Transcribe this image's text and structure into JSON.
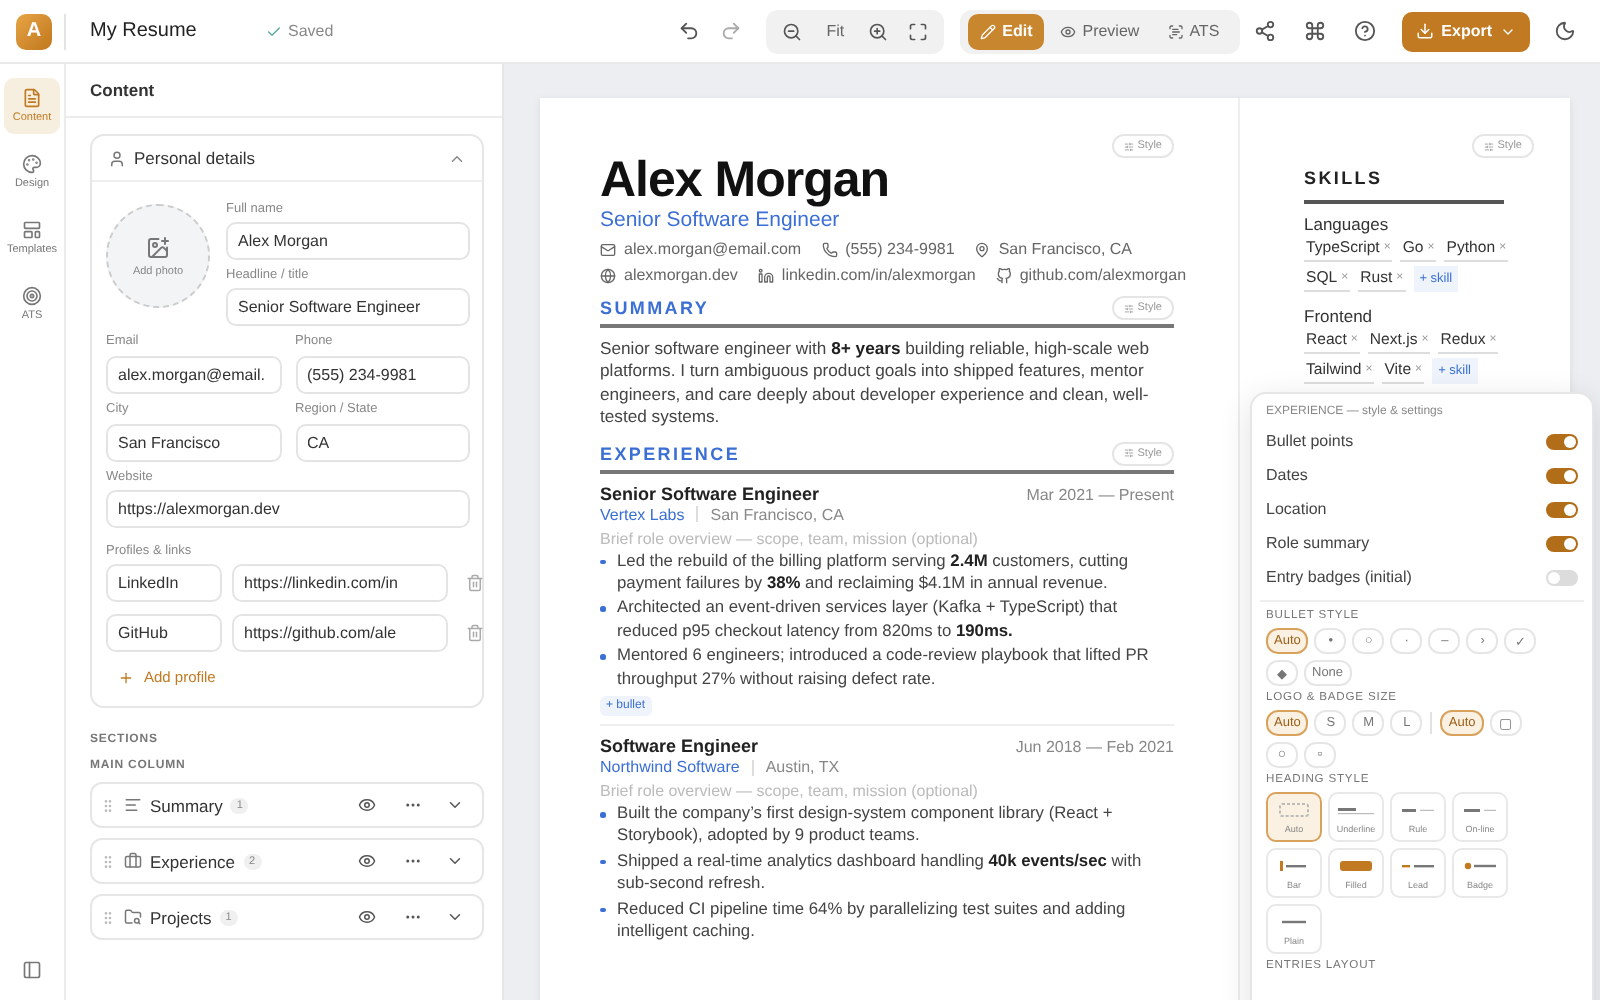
{
  "topbar": {
    "logo_letter": "A",
    "doc_title": "My Resume",
    "save_status": "Saved",
    "zoom_fit": "Fit",
    "modes": [
      {
        "label": "Edit",
        "kind": "edit",
        "selected": true
      },
      {
        "label": "Preview",
        "kind": "preview",
        "selected": false
      },
      {
        "label": "ATS",
        "kind": "ats",
        "selected": false
      }
    ],
    "export_label": "Export"
  },
  "rail": {
    "items": [
      {
        "label": "Content",
        "kind": "content",
        "selected": true
      },
      {
        "label": "Design",
        "kind": "design",
        "selected": false
      },
      {
        "label": "Templates",
        "kind": "templates",
        "selected": false
      },
      {
        "label": "ATS",
        "kind": "ats",
        "selected": false
      }
    ]
  },
  "panel": {
    "title": "Content",
    "personal": {
      "title": "Personal details",
      "expanded": true,
      "photo_label": "Add photo",
      "name_fields": [
        {
          "label": "Full name",
          "value": "Alex Morgan"
        },
        {
          "label": "Headline / title",
          "value": "Senior Software Engineer"
        }
      ],
      "grid_fields": [
        {
          "label": "Email",
          "value": "alex.morgan@email."
        },
        {
          "label": "Phone",
          "value": "(555) 234-9981"
        },
        {
          "label": "City",
          "value": "San Francisco"
        },
        {
          "label": "Region / State",
          "value": "CA"
        }
      ],
      "website": {
        "label": "Website",
        "value": "https://alexmorgan.dev"
      },
      "profiles_label": "Profiles & links",
      "profiles": [
        {
          "name": "LinkedIn",
          "url": "https://linkedin.com/in"
        },
        {
          "name": "GitHub",
          "url": "https://github.com/ale"
        }
      ],
      "add_profile": "Add profile"
    },
    "sections_label": "SECTIONS",
    "column_label": "MAIN COLUMN",
    "sections": [
      {
        "name": "Summary",
        "kind": "summary",
        "count": "1"
      },
      {
        "name": "Experience",
        "kind": "experience",
        "count": "2"
      },
      {
        "name": "Projects",
        "kind": "projects",
        "count": "1"
      }
    ]
  },
  "resume": {
    "style_label": "Style",
    "name": "Alex Morgan",
    "headline": "Senior Software Engineer",
    "contact_rows": [
      [
        {
          "kind": "email",
          "text": "alex.morgan@email.com"
        },
        {
          "kind": "phone",
          "text": "(555) 234-9981"
        },
        {
          "kind": "location",
          "text": "San Francisco, CA"
        }
      ],
      [
        {
          "kind": "website",
          "text": "alexmorgan.dev"
        },
        {
          "kind": "linkedin",
          "text": "linkedin.com/in/alexmorgan"
        },
        {
          "kind": "github",
          "text": "github.com/alexmorgan"
        }
      ]
    ],
    "summary": {
      "heading": "SUMMARY",
      "style_label": "Style",
      "text": "Senior software engineer with **8+ years** building reliable, high-scale web platforms. I turn ambiguous product goals into shipped features, mentor engineers, and care deeply about developer experience and clean, well-tested systems."
    },
    "experience": {
      "heading": "EXPERIENCE",
      "style_label": "Style",
      "entries": [
        {
          "role": "Senior Software Engineer",
          "company": "Vertex Labs",
          "location": "San Francisco, CA",
          "dates": "Mar 2021 — Present",
          "overview_placeholder": "Brief role overview — scope, team, mission (optional)",
          "bullets": [
            "Led the rebuild of the billing platform serving **2.4M** customers, cutting payment failures by **38%** and reclaiming $4.1M in annual revenue.",
            "Architected an event-driven services layer (Kafka + TypeScript) that reduced p95 checkout latency from 820ms to **190ms.**",
            "Mentored 6 engineers; introduced a code-review playbook that lifted PR throughput 27% without raising defect rate."
          ],
          "add_bullet": "+ bullet"
        },
        {
          "role": "Software Engineer",
          "company": "Northwind Software",
          "location": "Austin, TX",
          "dates": "Jun 2018 — Feb 2021",
          "overview_placeholder": "Brief role overview — scope, team, mission (optional)",
          "bullets": [
            "Built the company’s first design-system component library (React + Storybook), adopted by 9 product teams.",
            "Shipped a real-time analytics dashboard handling **40k events/sec** with sub-second refresh.",
            "Reduced CI pipeline time 64% by parallelizing test suites and adding intelligent caching."
          ]
        }
      ]
    },
    "skills": {
      "style_label": "Style",
      "heading": "SKILLS",
      "remove_mark": "×",
      "groups": [
        {
          "name": "Languages",
          "tags": [
            "TypeScript",
            "Go",
            "Python",
            "SQL",
            "Rust"
          ],
          "add_label": "+ skill"
        },
        {
          "name": "Frontend",
          "tags": [
            "React",
            "Next.js",
            "Redux",
            "Tailwind",
            "Vite"
          ],
          "add_label": "+ skill"
        }
      ]
    }
  },
  "popover": {
    "title": "EXPERIENCE — style & settings",
    "toggles": [
      {
        "label": "Bullet points",
        "on": true
      },
      {
        "label": "Dates",
        "on": true
      },
      {
        "label": "Location",
        "on": true
      },
      {
        "label": "Role summary",
        "on": true
      },
      {
        "label": "Entry badges (initial)",
        "on": false
      }
    ],
    "bullet_style": {
      "label": "BULLET STYLE",
      "options": [
        {
          "label": "Auto",
          "selected": true
        },
        {
          "label": "•",
          "selected": false
        },
        {
          "label": "○",
          "selected": false
        },
        {
          "label": "·",
          "selected": false
        },
        {
          "label": "–",
          "selected": false
        },
        {
          "label": "›",
          "selected": false
        },
        {
          "label": "✓",
          "selected": false
        },
        {
          "label": "◆",
          "selected": false
        },
        {
          "label": "None",
          "selected": false
        }
      ]
    },
    "logo_size": {
      "label": "LOGO & BADGE SIZE",
      "sizes": [
        {
          "label": "Auto",
          "selected": true
        },
        {
          "label": "S",
          "selected": false
        },
        {
          "label": "M",
          "selected": false
        },
        {
          "label": "L",
          "selected": false
        }
      ],
      "shapes": [
        {
          "label": "Auto",
          "kind": "text",
          "selected": true
        },
        {
          "label": "▢",
          "kind": "rounded",
          "selected": false
        },
        {
          "label": "○",
          "kind": "circle",
          "selected": false
        },
        {
          "label": "▫",
          "kind": "square",
          "selected": false
        }
      ]
    },
    "heading_style": {
      "label": "HEADING STYLE",
      "options": [
        {
          "label": "Auto",
          "kind": "auto",
          "selected": true
        },
        {
          "label": "Underline",
          "kind": "underline",
          "selected": false
        },
        {
          "label": "Rule",
          "kind": "rule",
          "selected": false
        },
        {
          "label": "On-line",
          "kind": "online",
          "selected": false
        },
        {
          "label": "Bar",
          "kind": "bar",
          "selected": false
        },
        {
          "label": "Filled",
          "kind": "filled",
          "selected": false
        },
        {
          "label": "Lead",
          "kind": "lead",
          "selected": false
        },
        {
          "label": "Badge",
          "kind": "badge",
          "selected": false
        },
        {
          "label": "Plain",
          "kind": "plain",
          "selected": false
        }
      ]
    },
    "entries_layout_label": "ENTRIES LAYOUT"
  }
}
